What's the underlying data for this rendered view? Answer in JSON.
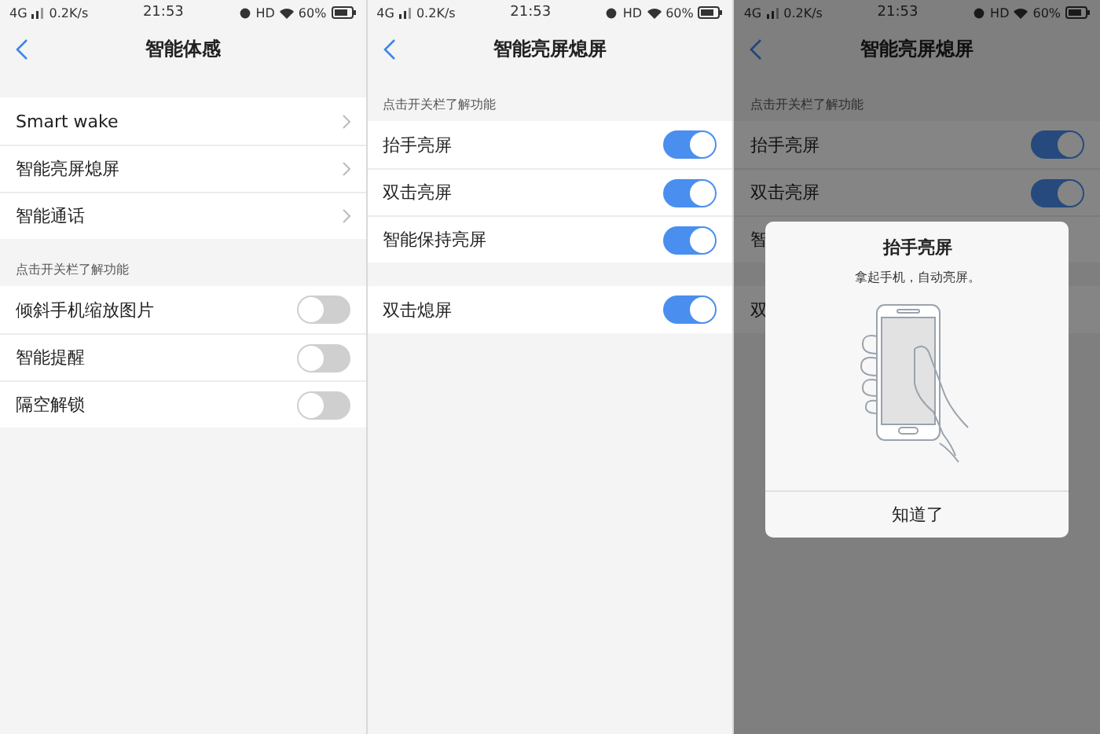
{
  "panels": [
    {
      "status": {
        "network": "4G",
        "speed": "0.2K/s",
        "time": "21:53",
        "hd": "HD",
        "battery": "60%"
      },
      "title": "智能体感",
      "dimmed": false,
      "groups": [
        {
          "rows": [
            {
              "label": "Smart wake",
              "kind": "link"
            },
            {
              "label": "智能亮屏熄屏",
              "kind": "link"
            },
            {
              "label": "智能通话",
              "kind": "link"
            }
          ]
        },
        {
          "header": "点击开关栏了解功能",
          "rows": [
            {
              "label": "倾斜手机缩放图片",
              "kind": "switch",
              "on": false
            },
            {
              "label": "智能提醒",
              "kind": "switch",
              "on": false
            },
            {
              "label": "隔空解锁",
              "kind": "switch",
              "on": false
            }
          ]
        }
      ]
    },
    {
      "status": {
        "network": "4G",
        "speed": "0.2K/s",
        "time": "21:53",
        "hd": "HD",
        "battery": "60%"
      },
      "title": "智能亮屏熄屏",
      "dimmed": false,
      "groups": [
        {
          "header": "点击开关栏了解功能",
          "rows": [
            {
              "label": "抬手亮屏",
              "kind": "switch",
              "on": true
            },
            {
              "label": "双击亮屏",
              "kind": "switch",
              "on": true
            },
            {
              "label": "智能保持亮屏",
              "kind": "switch",
              "on": true
            }
          ]
        },
        {
          "rows": [
            {
              "label": "双击熄屏",
              "kind": "switch",
              "on": true
            }
          ]
        }
      ]
    },
    {
      "status": {
        "network": "4G",
        "speed": "0.2K/s",
        "time": "21:53",
        "hd": "HD",
        "battery": "60%"
      },
      "title": "智能亮屏熄屏",
      "dimmed": true,
      "groups": [
        {
          "header": "点击开关栏了解功能",
          "rows": [
            {
              "label": "抬手亮屏",
              "kind": "switch",
              "on": true
            },
            {
              "label": "双击亮屏",
              "kind": "switch",
              "on": true
            },
            {
              "label": "智",
              "kind": "label"
            }
          ]
        },
        {
          "rows": [
            {
              "label": "双",
              "kind": "label"
            }
          ]
        }
      ],
      "dialog": {
        "title": "抬手亮屏",
        "message": "拿起手机，自动亮屏。",
        "button": "知道了"
      }
    }
  ]
}
